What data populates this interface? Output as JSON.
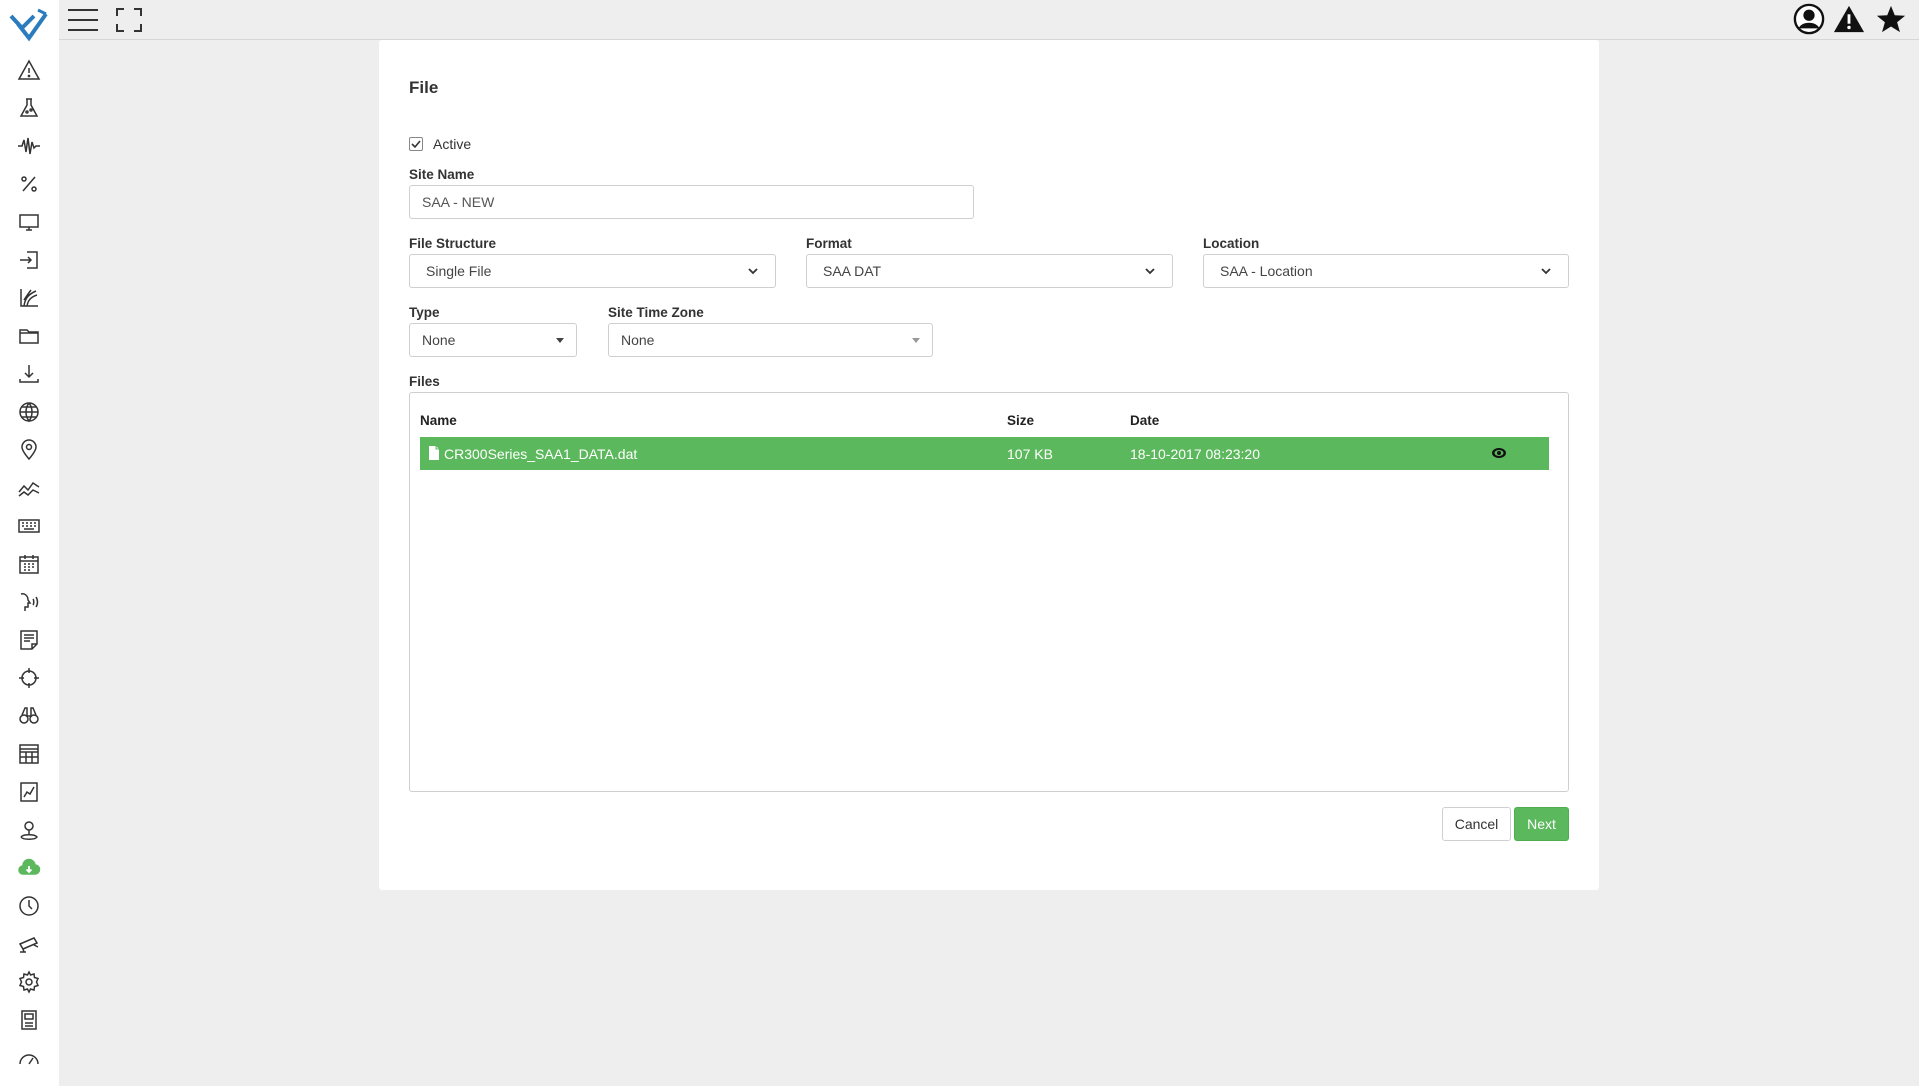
{
  "form": {
    "title": "File",
    "active_label": "Active",
    "active_checked": true,
    "site_name_label": "Site Name",
    "site_name_value": "SAA - NEW",
    "file_structure_label": "File Structure",
    "file_structure_value": "Single File",
    "format_label": "Format",
    "format_value": "SAA DAT",
    "location_label": "Location",
    "location_value": "SAA - Location",
    "type_label": "Type",
    "type_value": "None",
    "timezone_label": "Site Time Zone",
    "timezone_value": "None"
  },
  "files": {
    "label": "Files",
    "columns": {
      "name": "Name",
      "size": "Size",
      "date": "Date"
    },
    "rows": [
      {
        "name": "CR300Series_SAA1_DATA.dat",
        "size": "107 KB",
        "date": "18-10-2017 08:23:20"
      }
    ]
  },
  "buttons": {
    "cancel": "Cancel",
    "next": "Next"
  },
  "colors": {
    "accent": "#5cb85c",
    "logo": "#2b7bbf"
  },
  "sidebar_icons": [
    "alert-icon",
    "flask-icon",
    "waveform-icon",
    "percent-icon",
    "monitor-icon",
    "sign-in-icon",
    "plant-icon",
    "folder-icon",
    "download-icon",
    "globe-icon",
    "map-pin-icon",
    "trend-icon",
    "keyboard-icon",
    "calendar-icon",
    "sensor-face-icon",
    "notes-icon",
    "crosshair-icon",
    "binoculars-icon",
    "table-layout-icon",
    "chart-file-icon",
    "location-user-icon",
    "cloud-download-icon",
    "clock-icon",
    "camera-cctv-icon",
    "gear-icon",
    "device-icon",
    "gauge-icon"
  ],
  "topbar_icons": [
    "hamburger-menu-icon",
    "fullscreen-icon",
    "user-icon",
    "warning-icon",
    "star-icon"
  ]
}
